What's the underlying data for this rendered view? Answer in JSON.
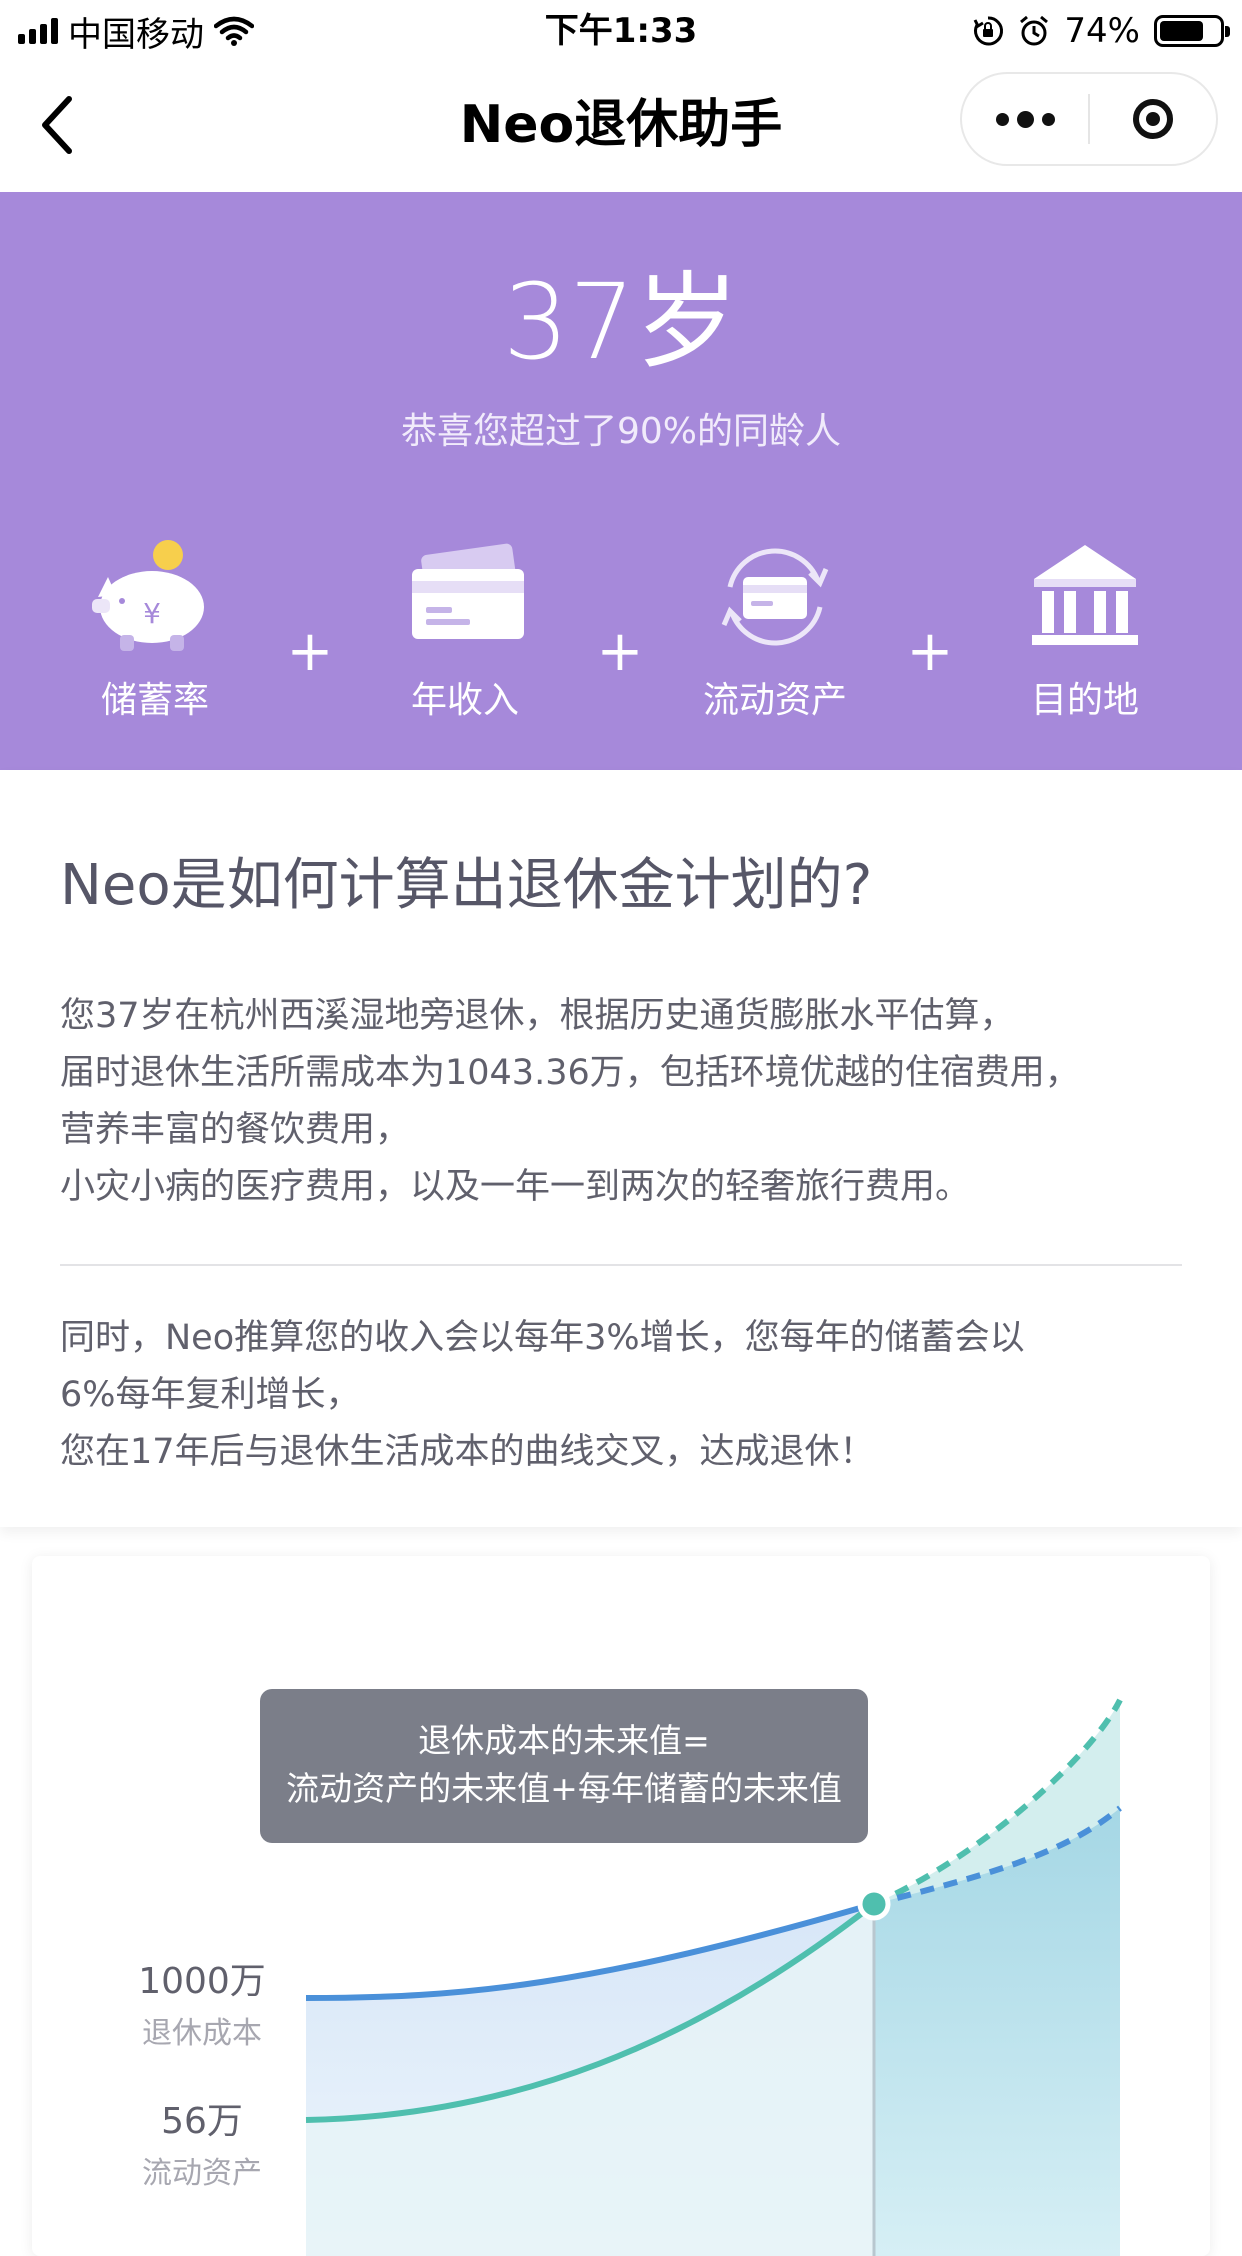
{
  "status_bar": {
    "carrier": "中国移动",
    "time": "下午1:33",
    "battery_text": "74%",
    "battery_level": 0.74,
    "icons": [
      "signal-icon",
      "wifi-icon",
      "rotation-lock-icon",
      "alarm-icon",
      "battery-icon"
    ]
  },
  "nav": {
    "title": "Neo退休助手",
    "icons": [
      "back-chevron-icon",
      "more-dots-icon",
      "target-icon"
    ]
  },
  "hero": {
    "age": "37岁",
    "subtitle": "恭喜您超过了90%的同龄人",
    "background_color": "#a689da",
    "factors": [
      {
        "label": "储蓄率",
        "icon": "piggy-bank-icon"
      },
      {
        "label": "年收入",
        "icon": "credit-card-icon"
      },
      {
        "label": "流动资产",
        "icon": "card-cycle-icon"
      },
      {
        "label": "目的地",
        "icon": "bank-building-icon"
      }
    ],
    "plus": "+"
  },
  "explanation": {
    "title": "Neo是如何计算出退休金计划的?",
    "para1": [
      "您37岁在杭州西溪湿地旁退休，根据历史通货膨胀水平估算，",
      "届时退休生活所需成本为1043.36万，包括环境优越的住宿费用，",
      "营养丰富的餐饮费用，",
      "小灾小病的医疗费用，以及一年一到两次的轻奢旅行费用。"
    ],
    "para2": [
      "同时，Neo推算您的收入会以每年3%增长，您每年的储蓄会以",
      "6%每年复利增长，",
      "您在17年后与退休生活成本的曲线交叉，达成退休！"
    ]
  },
  "chart": {
    "tooltip": [
      "退休成本的未来值=",
      "流动资产的未来值+每年储蓄的未来值"
    ],
    "labels": [
      {
        "value": "1000万",
        "name": "退休成本"
      },
      {
        "value": "56万",
        "name": "流动资产"
      }
    ],
    "colors": {
      "cost": "#4a90d9",
      "assets": "#4fbfae",
      "fill": "#a9d8e6"
    }
  }
}
